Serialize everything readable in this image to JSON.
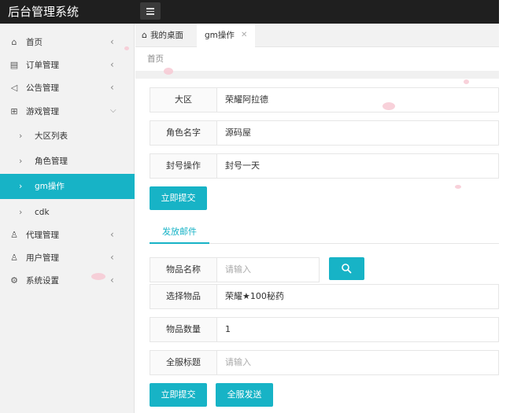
{
  "app": {
    "title": "后台管理系统"
  },
  "sidebar": {
    "items": [
      {
        "label": "首页",
        "icon": "home-icon"
      },
      {
        "label": "订单管理",
        "icon": "order-icon"
      },
      {
        "label": "公告管理",
        "icon": "speaker-icon"
      },
      {
        "label": "游戏管理",
        "icon": "game-icon"
      },
      {
        "label": "代理管理",
        "icon": "user-icon"
      },
      {
        "label": "用户管理",
        "icon": "user-icon"
      },
      {
        "label": "系统设置",
        "icon": "gear-icon"
      }
    ],
    "sub_items": [
      {
        "label": "大区列表"
      },
      {
        "label": "角色管理"
      },
      {
        "label": "gm操作"
      },
      {
        "label": "cdk"
      }
    ]
  },
  "tabs": [
    {
      "label": "我的桌面"
    },
    {
      "label": "gm操作"
    }
  ],
  "breadcrumb": "首页",
  "form1": {
    "region": {
      "label": "大区",
      "value": "荣耀阿拉德"
    },
    "role": {
      "label": "角色名字",
      "value": "源码屋"
    },
    "ban": {
      "label": "封号操作",
      "value": "封号一天"
    },
    "submit_label": "立即提交"
  },
  "mail_tab": "发放邮件",
  "form2": {
    "item_name": {
      "label": "物品名称",
      "placeholder": "请输入"
    },
    "item_select": {
      "label": "选择物品",
      "value": "荣耀★100秘药"
    },
    "item_qty": {
      "label": "物品数量",
      "value": "1"
    },
    "mail_title": {
      "label": "全服标题",
      "placeholder": "请输入"
    },
    "submit_label": "立即提交",
    "send_all_label": "全服发送"
  },
  "colors": {
    "accent": "#17b3c6",
    "topbar": "#1f1f1f",
    "sidebar": "#f2f2f2"
  }
}
